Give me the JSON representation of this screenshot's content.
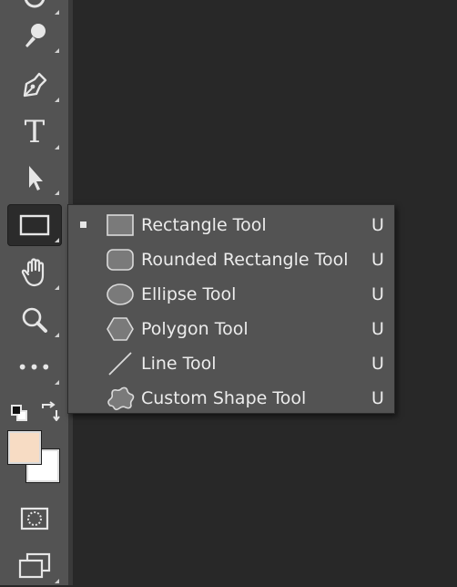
{
  "toolbar": {
    "tools": [
      {
        "name": "spot-healing-tool",
        "icon": "bandage-icon"
      },
      {
        "name": "brush-tool",
        "icon": "brush-icon"
      },
      {
        "name": "pen-tool",
        "icon": "pen-nib-icon"
      },
      {
        "name": "type-tool",
        "icon": "type-t-icon",
        "glyph": "T"
      },
      {
        "name": "path-selection-tool",
        "icon": "arrow-cursor-icon"
      },
      {
        "name": "rectangle-tool",
        "icon": "rectangle-icon",
        "active": true
      },
      {
        "name": "hand-tool",
        "icon": "hand-icon"
      },
      {
        "name": "zoom-tool",
        "icon": "magnifier-icon"
      },
      {
        "name": "edit-toolbar",
        "icon": "ellipsis-icon",
        "glyph": "•••"
      }
    ],
    "colors": {
      "foreground": "#f7dcc4",
      "background": "#ffffff"
    }
  },
  "flyout": {
    "items": [
      {
        "label": "Rectangle Tool",
        "shortcut": "U",
        "icon": "rectangle-shape-icon",
        "selected": true
      },
      {
        "label": "Rounded Rectangle Tool",
        "shortcut": "U",
        "icon": "rounded-rectangle-icon",
        "selected": false
      },
      {
        "label": "Ellipse Tool",
        "shortcut": "U",
        "icon": "ellipse-icon",
        "selected": false
      },
      {
        "label": "Polygon Tool",
        "shortcut": "U",
        "icon": "polygon-icon",
        "selected": false
      },
      {
        "label": "Line Tool",
        "shortcut": "U",
        "icon": "line-icon",
        "selected": false
      },
      {
        "label": "Custom Shape Tool",
        "shortcut": "U",
        "icon": "custom-shape-icon",
        "selected": false
      }
    ]
  },
  "ui_colors": {
    "toolbar_bg": "#535353",
    "canvas_bg": "#282828",
    "active_tool_bg": "#2b2b2b",
    "text": "#ececec"
  }
}
